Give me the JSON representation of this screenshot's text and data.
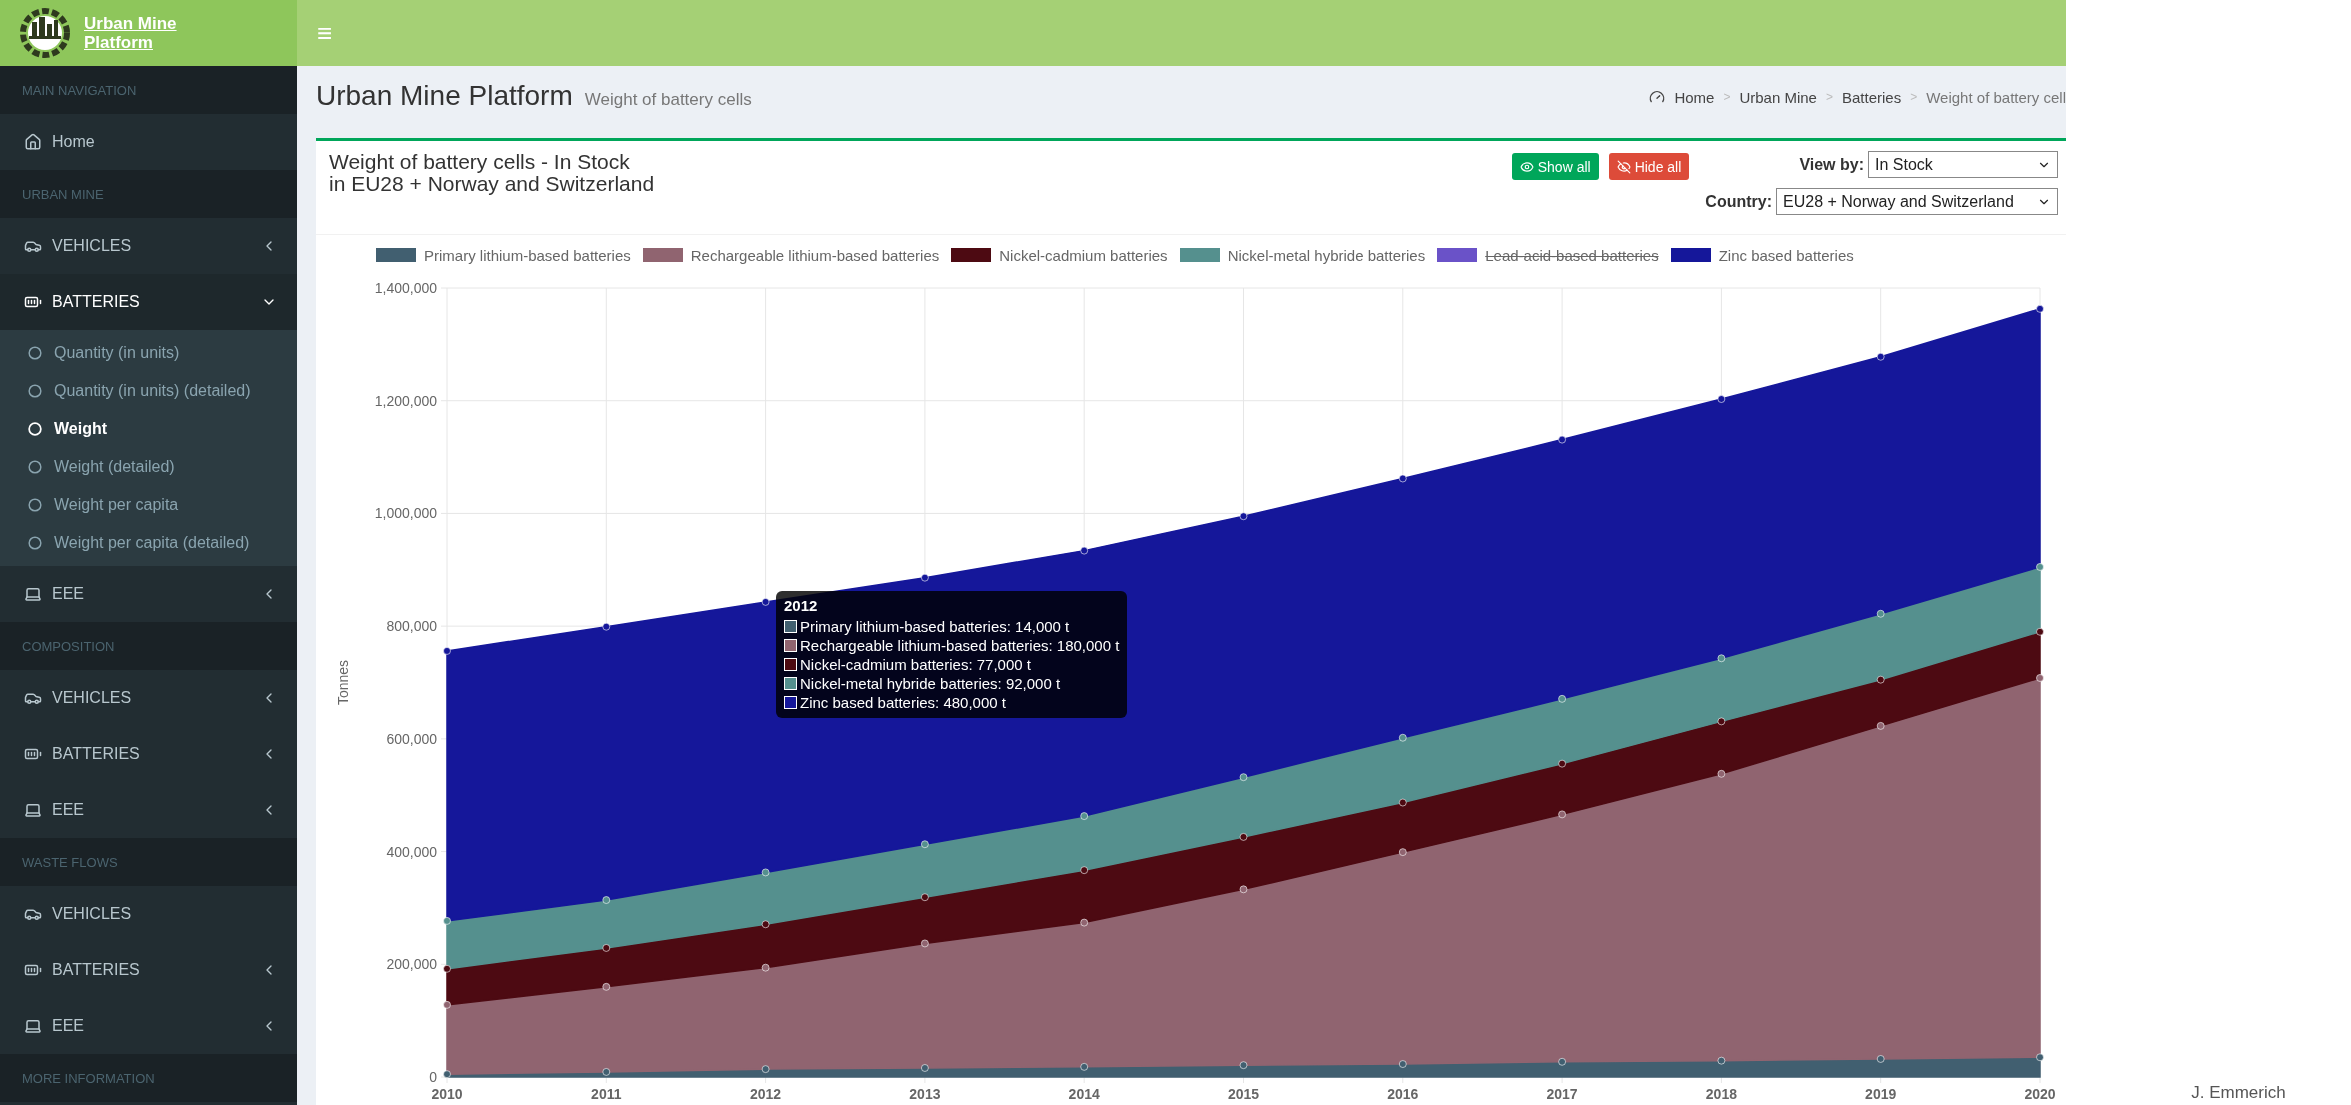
{
  "logo": {
    "lines": [
      "Urban Mine",
      "Platform"
    ]
  },
  "topbar": {
    "menu_glyph": "≡"
  },
  "sidebar": {
    "sections": [
      {
        "header": "MAIN NAVIGATION",
        "items": [
          {
            "label": "Home",
            "kind": "home",
            "collapsible": false
          }
        ]
      },
      {
        "header": "URBAN MINE",
        "items": [
          {
            "label": "VEHICLES",
            "kind": "car",
            "collapsible": true,
            "expanded": false
          },
          {
            "label": "BATTERIES",
            "kind": "battery",
            "collapsible": true,
            "expanded": true,
            "children": [
              {
                "label": "Quantity (in units)",
                "selected": false
              },
              {
                "label": "Quantity (in units) (detailed)",
                "selected": false
              },
              {
                "label": "Weight",
                "selected": true
              },
              {
                "label": "Weight (detailed)",
                "selected": false
              },
              {
                "label": "Weight per capita",
                "selected": false
              },
              {
                "label": "Weight per capita (detailed)",
                "selected": false
              }
            ]
          },
          {
            "label": "EEE",
            "kind": "laptop",
            "collapsible": true,
            "expanded": false
          }
        ]
      },
      {
        "header": "COMPOSITION",
        "items": [
          {
            "label": "VEHICLES",
            "kind": "car",
            "collapsible": true,
            "expanded": false
          },
          {
            "label": "BATTERIES",
            "kind": "battery",
            "collapsible": true,
            "expanded": false
          },
          {
            "label": "EEE",
            "kind": "laptop",
            "collapsible": true,
            "expanded": false
          }
        ]
      },
      {
        "header": "WASTE FLOWS",
        "items": [
          {
            "label": "VEHICLES",
            "kind": "car",
            "collapsible": false
          },
          {
            "label": "BATTERIES",
            "kind": "battery",
            "collapsible": true,
            "expanded": false
          },
          {
            "label": "EEE",
            "kind": "laptop",
            "collapsible": true,
            "expanded": false
          }
        ]
      },
      {
        "header": "MORE INFORMATION"
      }
    ]
  },
  "page_header": {
    "title": "Urban Mine Platform",
    "subtitle": "Weight of battery cells"
  },
  "breadcrumb": {
    "separator": ">",
    "items": [
      "Home",
      "Urban Mine",
      "Batteries",
      "Weight of battery cell"
    ]
  },
  "box": {
    "title_lines": [
      "Weight of battery cells - In Stock",
      "in EU28 + Norway and Switzerland"
    ],
    "buttons": [
      {
        "kind": "show",
        "label": "Show all"
      },
      {
        "kind": "hide",
        "label": "Hide all"
      }
    ],
    "filters": [
      {
        "label": "View by:",
        "value": "In Stock"
      },
      {
        "label": "Country:",
        "value": "EU28 + Norway and Switzerland"
      }
    ]
  },
  "legend": [
    {
      "hidden": false
    },
    {
      "hidden": false
    },
    {
      "hidden": false
    },
    {
      "hidden": false
    },
    {
      "hidden": true
    },
    {
      "hidden": false
    }
  ],
  "chart_data": {
    "type": "area",
    "stacked": true,
    "grid": true,
    "ylabel": "Tonnes",
    "x": [
      "2010",
      "2011",
      "2012",
      "2013",
      "2014",
      "2015",
      "2016",
      "2017",
      "2018",
      "2019",
      "2020"
    ],
    "ylim": [
      0,
      1400000
    ],
    "yticks": [
      {
        "value": 0,
        "label": "0"
      },
      {
        "value": 200000,
        "label": "200,000"
      },
      {
        "value": 400000,
        "label": "400,000"
      },
      {
        "value": 600000,
        "label": "600,000"
      },
      {
        "value": 800000,
        "label": "800,000"
      },
      {
        "value": 1000000,
        "label": "1,000,000"
      },
      {
        "value": 1200000,
        "label": "1,200,000"
      },
      {
        "value": 1400000,
        "label": "1,400,000"
      }
    ],
    "series": [
      {
        "name": "Primary lithium-based batteries",
        "color": "#415f70",
        "values": [
          5000,
          9000,
          14000,
          16000,
          18000,
          21000,
          23000,
          27000,
          29000,
          32000,
          35000
        ]
      },
      {
        "name": "Rechargeable lithium-based batteries",
        "color": "#906470",
        "values": [
          123000,
          151000,
          180000,
          221000,
          256000,
          312000,
          376000,
          439000,
          509000,
          591000,
          673000
        ]
      },
      {
        "name": "Nickel-cadmium batteries",
        "color": "#4d0a12",
        "values": [
          64000,
          69000,
          77000,
          82000,
          93000,
          93000,
          88000,
          90000,
          93000,
          82000,
          82000
        ]
      },
      {
        "name": "Nickel-metal hybride batteries",
        "color": "#55908e",
        "values": [
          85000,
          85000,
          92000,
          94000,
          96000,
          106000,
          115000,
          115000,
          112000,
          117000,
          115000
        ]
      },
      {
        "name": "Lead-acid-based batteries",
        "color": "#6a52c8",
        "values": [
          null,
          null,
          null,
          null,
          null,
          null,
          null,
          null,
          null,
          null,
          null
        ]
      },
      {
        "name": "Zinc based batteries",
        "color": "#15179a",
        "values": [
          479000,
          485000,
          480000,
          473000,
          471000,
          463000,
          460000,
          460000,
          460000,
          456000,
          458000
        ]
      }
    ]
  },
  "tooltip": {
    "title": "2012",
    "items": [
      {
        "text": "Primary lithium-based batteries: 14,000 t",
        "color": "#415f70"
      },
      {
        "text": "Rechargeable lithium-based batteries: 180,000 t",
        "color": "#906470"
      },
      {
        "text": "Nickel-cadmium batteries: 77,000 t",
        "color": "#4d0a12"
      },
      {
        "text": "Nickel-metal hybride batteries: 92,000 t",
        "color": "#55908e"
      },
      {
        "text": "Zinc based batteries: 480,000 t",
        "color": "#15179a"
      }
    ]
  },
  "signature": "J. Emmerich"
}
